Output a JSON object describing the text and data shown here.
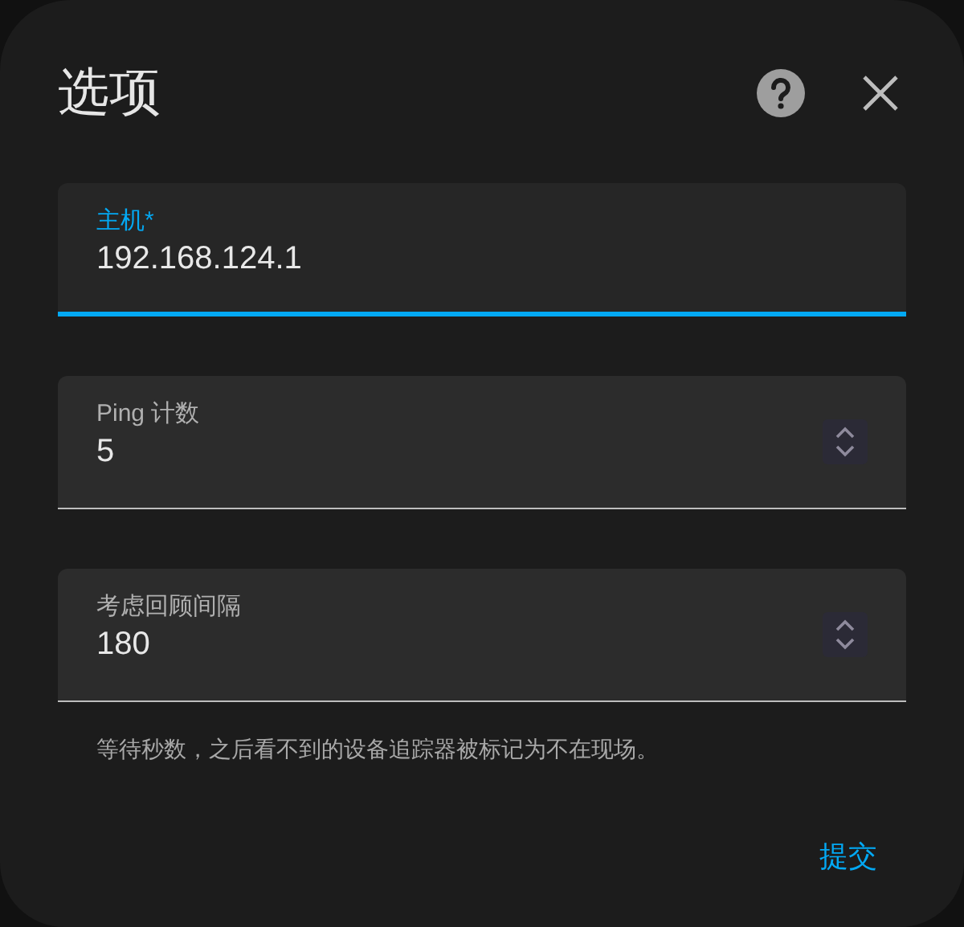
{
  "dialog": {
    "title": "选项"
  },
  "fields": [
    {
      "kind": "text",
      "label": "主机*",
      "value": "192.168.124.1",
      "focused": true
    },
    {
      "kind": "number",
      "label": "Ping 计数",
      "value": "5",
      "focused": false
    },
    {
      "kind": "number",
      "label": "考虑回顾间隔",
      "value": "180",
      "focused": false,
      "helper": "等待秒数，之后看不到的设备追踪器被标记为不在现场。"
    }
  ],
  "actions": [
    {
      "label": "提交"
    }
  ]
}
